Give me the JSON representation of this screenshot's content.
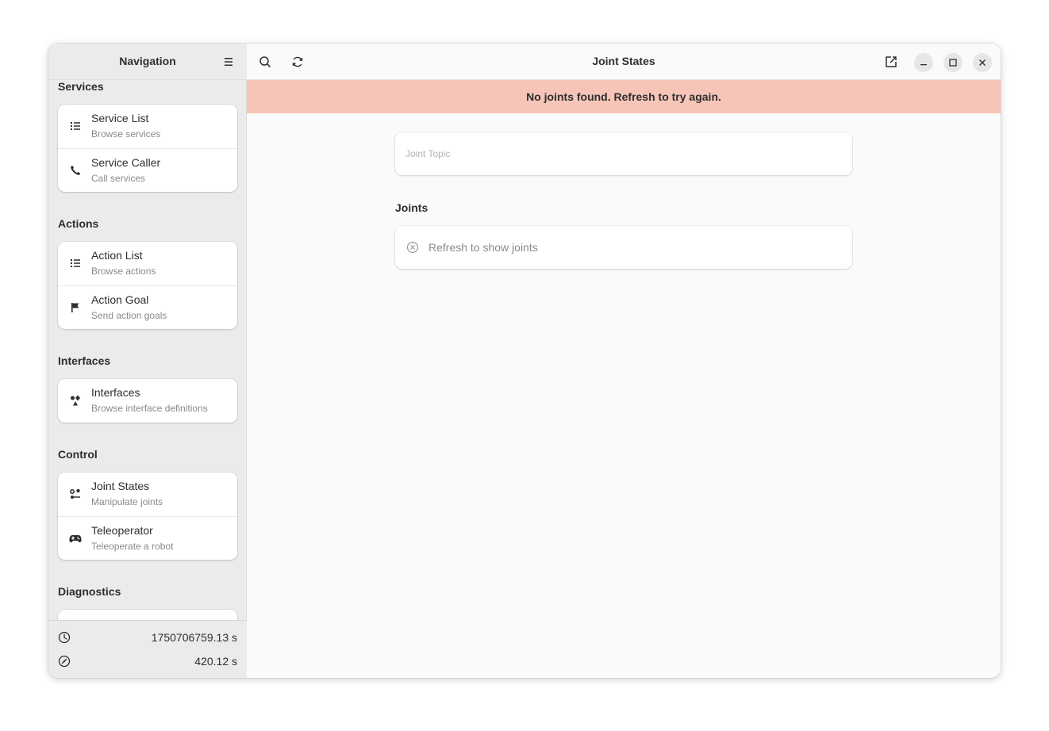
{
  "sidebar": {
    "title": "Navigation",
    "sections": [
      {
        "heading": "Services",
        "items": [
          {
            "title": "Service List",
            "subtitle": "Browse services",
            "icon": "list-icon"
          },
          {
            "title": "Service Caller",
            "subtitle": "Call services",
            "icon": "phone-icon"
          }
        ]
      },
      {
        "heading": "Actions",
        "items": [
          {
            "title": "Action List",
            "subtitle": "Browse actions",
            "icon": "list-icon"
          },
          {
            "title": "Action Goal",
            "subtitle": "Send action goals",
            "icon": "flag-icon"
          }
        ]
      },
      {
        "heading": "Interfaces",
        "items": [
          {
            "title": "Interfaces",
            "subtitle": "Browse interface definitions",
            "icon": "shapes-icon"
          }
        ]
      },
      {
        "heading": "Control",
        "items": [
          {
            "title": "Joint States",
            "subtitle": "Manipulate joints",
            "icon": "joints-icon"
          },
          {
            "title": "Teleoperator",
            "subtitle": "Teleoperate a robot",
            "icon": "gamepad-icon"
          }
        ]
      },
      {
        "heading": "Diagnostics",
        "items": []
      }
    ],
    "footer": {
      "time_value": "1750706759.13 s",
      "elapsed_value": "420.12 s"
    }
  },
  "main": {
    "title": "Joint States",
    "banner": "No joints found. Refresh to try again.",
    "topic_placeholder": "Joint Topic",
    "joints_heading": "Joints",
    "empty_text": "Refresh to show joints"
  },
  "colors": {
    "banner_bg": "#f6c5b8",
    "sidebar_bg": "#ebebeb",
    "content_bg": "#fafafa"
  }
}
